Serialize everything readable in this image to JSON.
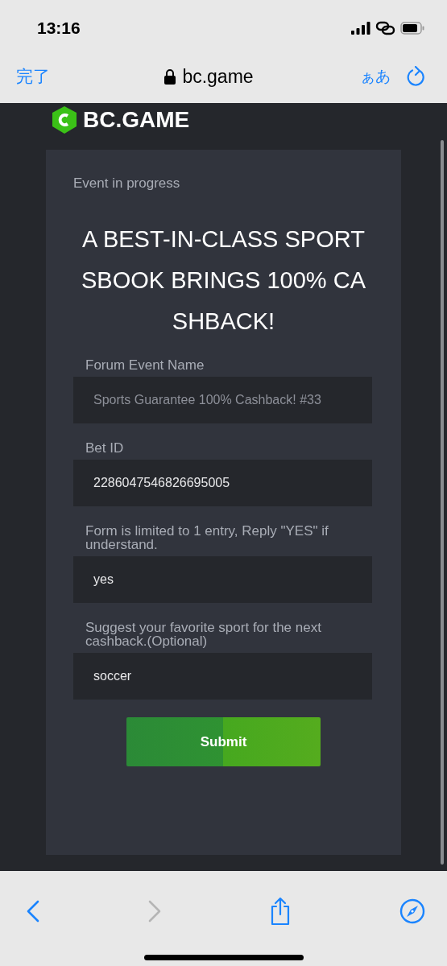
{
  "status_bar": {
    "time": "13:16"
  },
  "browser": {
    "done": "完了",
    "url": "bc.game",
    "text_size": "ぁあ"
  },
  "site": {
    "logo": "BC.GAME"
  },
  "form": {
    "status": "Event in progress",
    "title": "A BEST-IN-CLASS SPORTSBOOK BRINGS 100% CASHBACK!",
    "fields": [
      {
        "label": "Forum Event Name",
        "value": "Sports Guarantee 100% Cashback! #33",
        "disabled": true
      },
      {
        "label": "Bet ID",
        "value": "2286047546826695005",
        "disabled": false
      },
      {
        "label": "Form is limited to 1 entry, Reply \"YES\" if understand.",
        "value": "yes",
        "disabled": false
      },
      {
        "label": "Suggest your favorite sport for the next cashback.(Optional)",
        "value": "soccer",
        "disabled": false
      }
    ],
    "submit": "Submit"
  },
  "toolbar": {
    "back_disabled": false,
    "forward_disabled": true
  }
}
